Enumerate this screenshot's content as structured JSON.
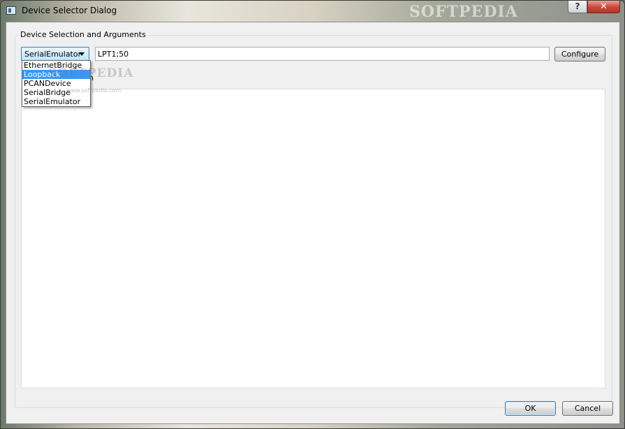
{
  "window": {
    "title": "Device Selector Dialog",
    "help_label": "?",
    "close_label": "✕",
    "watermark": "SOFTPEDIA"
  },
  "group": {
    "legend": "Device Selection and Arguments",
    "combo_value": "SerialEmulator",
    "arguments_value": "LPT1;50",
    "configure_label": "Configure",
    "dropdown_items": [
      "EthernetBridge",
      "Loopback",
      "PCANDevice",
      "SerialBridge",
      "SerialEmulator"
    ],
    "dropdown_selected": "Loopback",
    "inner_legend_fragment": "n",
    "watermark": "SOFTPEDIA",
    "watermark_url": "www.softpedia.com"
  },
  "buttons": {
    "ok_label": "OK",
    "cancel_label": "Cancel"
  },
  "colors": {
    "selection": "#3399ff",
    "close_button": "#c8473a",
    "default_button_border": "#3c7fb1"
  }
}
